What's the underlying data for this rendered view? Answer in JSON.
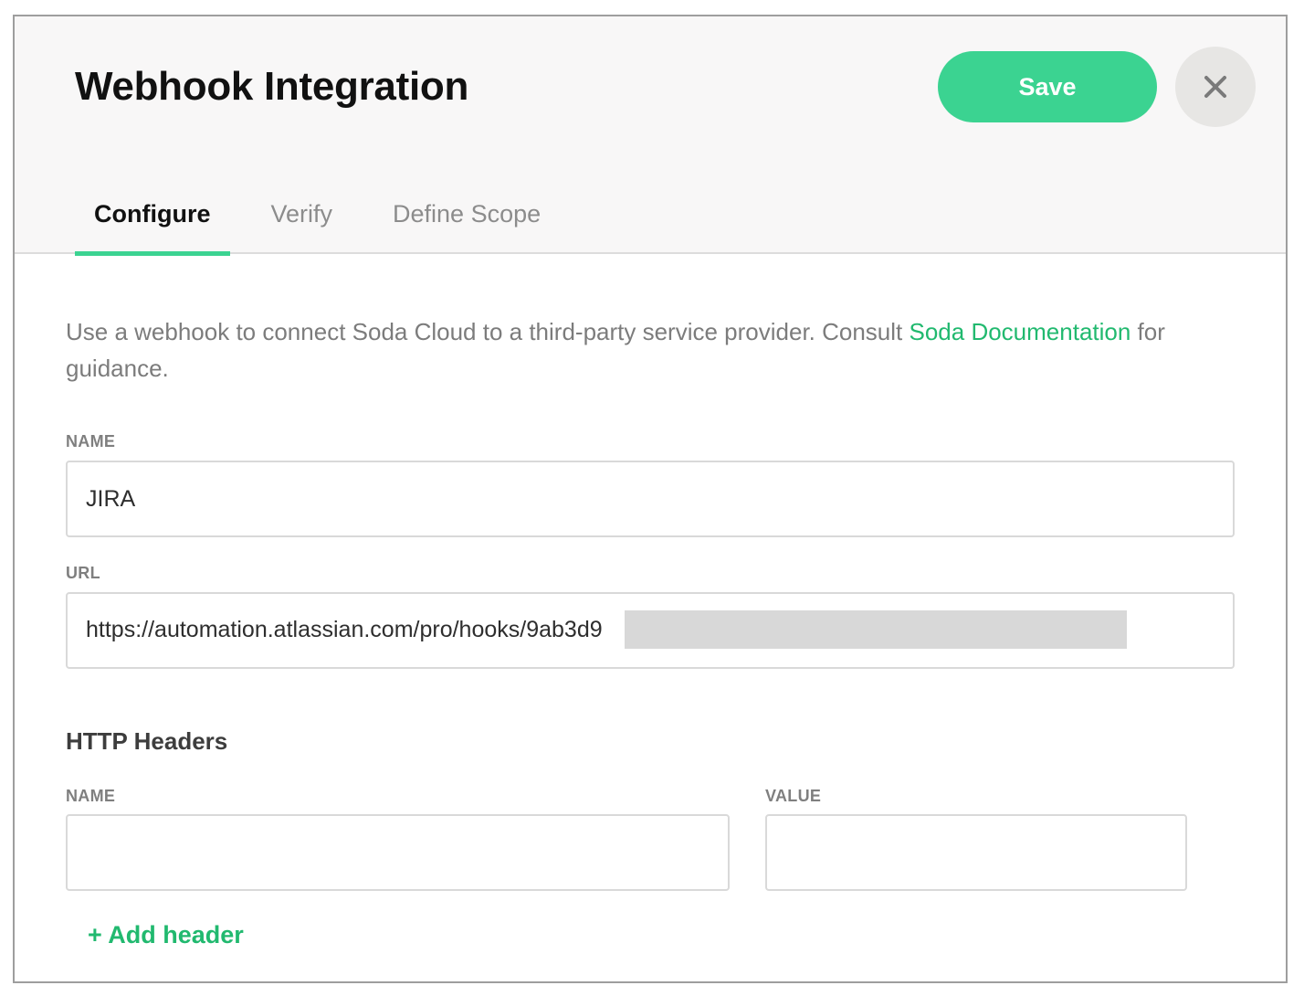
{
  "dialog": {
    "title": "Webhook Integration",
    "save_label": "Save",
    "close_icon": "close-icon"
  },
  "tabs": [
    {
      "label": "Configure",
      "active": true
    },
    {
      "label": "Verify",
      "active": false
    },
    {
      "label": "Define Scope",
      "active": false
    }
  ],
  "description": {
    "before_link": "Use a webhook to connect Soda Cloud to a third-party service provider. Consult ",
    "link_text": "Soda Documentation",
    "after_link": " for guidance."
  },
  "form": {
    "name_label": "NAME",
    "name_value": "JIRA",
    "url_label": "URL",
    "url_value": "https://automation.atlassian.com/pro/hooks/9ab3d9"
  },
  "http_headers": {
    "title": "HTTP Headers",
    "name_label": "NAME",
    "value_label": "VALUE",
    "name_value": "",
    "value_value": "",
    "add_label": "+ Add header"
  },
  "colors": {
    "accent": "#3bd391",
    "link": "#21b96f",
    "header_bg": "#f8f7f7"
  }
}
